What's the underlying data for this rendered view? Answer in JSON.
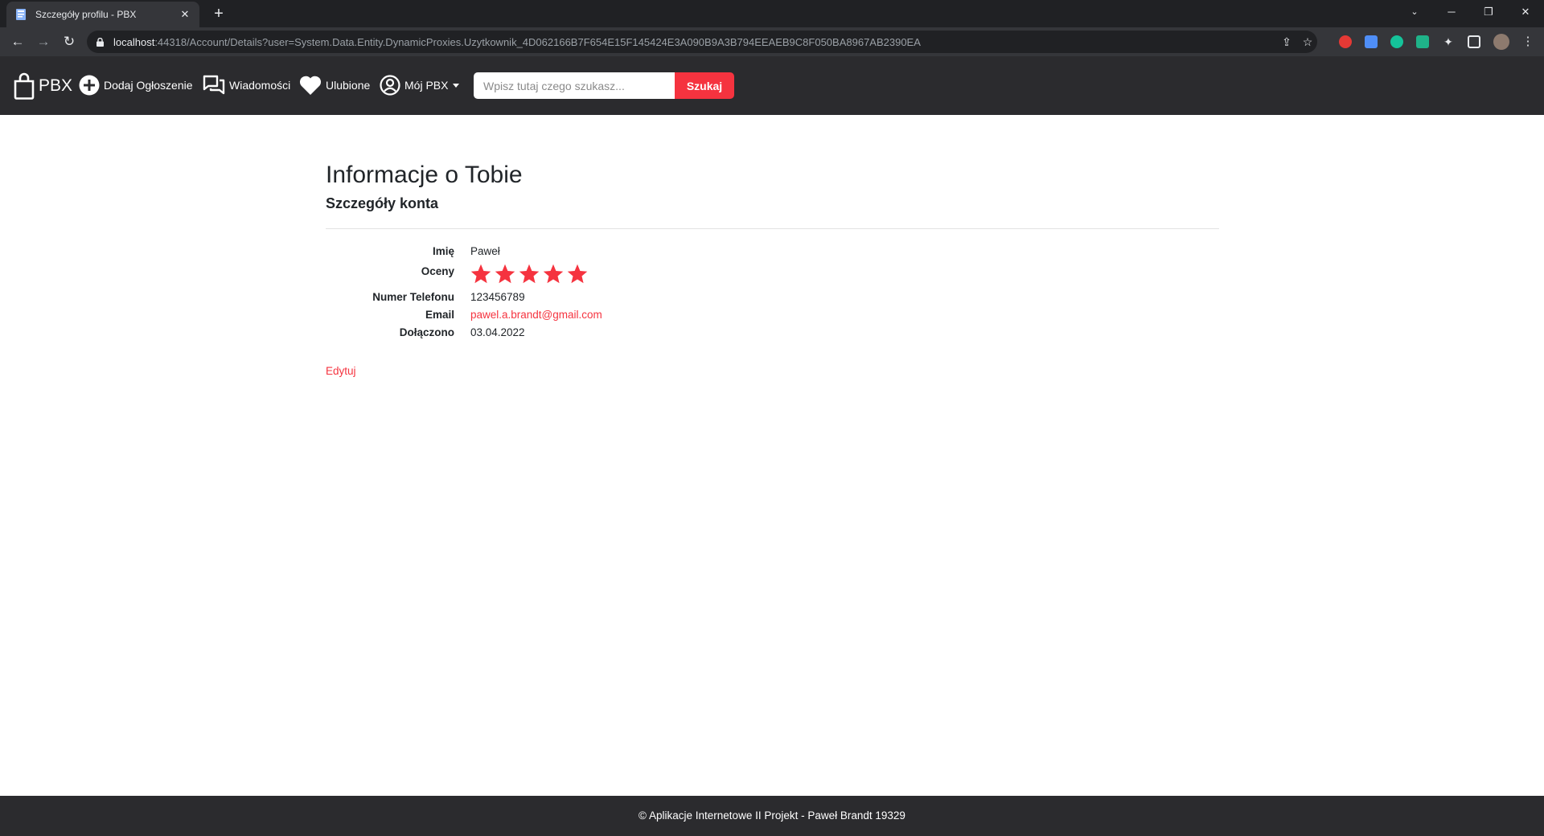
{
  "browser": {
    "tab_title": "Szczegóły profilu - PBX",
    "new_tab": "+",
    "url_host": "localhost",
    "url_rest": ":44318/Account/Details?user=System.Data.Entity.DynamicProxies.Uzytkownik_4D062166B7F654E15F145424E3A090B9A3B794EEAEB9C8F050BA8967AB2390EA"
  },
  "navbar": {
    "brand": "PBX",
    "add_listing": "Dodaj Ogłoszenie",
    "messages": "Wiadomości",
    "favorites": "Ulubione",
    "my_account": "Mój PBX",
    "search_placeholder": "Wpisz tutaj czego szukasz...",
    "search_button": "Szukaj"
  },
  "page": {
    "title": "Informacje o Tobie",
    "subtitle": "Szczegóły konta",
    "fields": {
      "name_label": "Imię",
      "name_value": "Paweł",
      "rating_label": "Oceny",
      "rating_value": 5,
      "rating_max": 5,
      "phone_label": "Numer Telefonu",
      "phone_value": "123456789",
      "email_label": "Email",
      "email_value": "pawel.a.brandt@gmail.com",
      "joined_label": "Dołączono",
      "joined_value": "03.04.2022"
    },
    "edit_link": "Edytuj"
  },
  "footer": {
    "text": "© Aplikacje Internetowe II Projekt - Paweł Brandt 19329"
  },
  "colors": {
    "accent": "#f5333f",
    "navbar_bg": "#2b2b2e"
  }
}
